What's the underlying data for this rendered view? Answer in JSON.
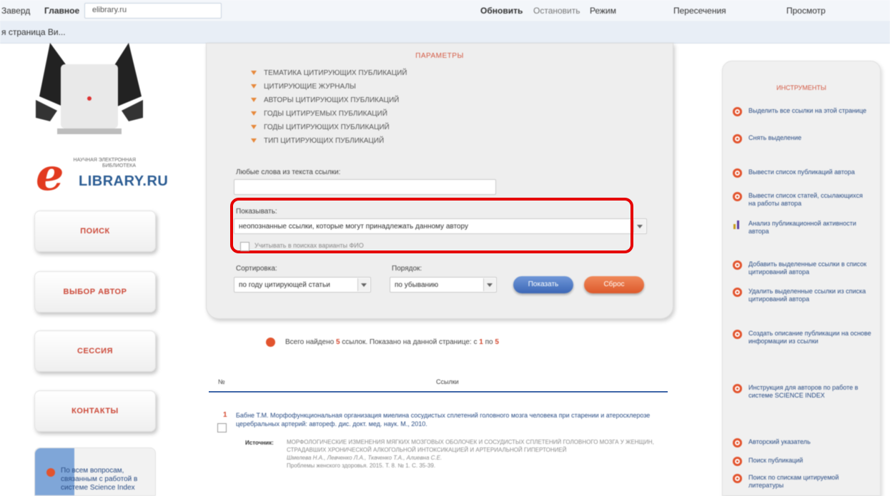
{
  "browser": {
    "tab_left": "Заверд",
    "tab_left2": "Главное",
    "address": "elibrary.ru",
    "refresh_label": "Обновить",
    "stop_label": "Остановить",
    "tools_label": "Режим",
    "page_label": "Пересечения",
    "extra_label": "Просмотр"
  },
  "bookmarks": {
    "page_label": "я страница Ви..."
  },
  "logo": {
    "tagline": "НАУЧНАЯ ЭЛЕКТРОННАЯ БИБЛИОТЕКА",
    "letter": "e",
    "name": "LIBRARY.RU"
  },
  "nav": {
    "search": "ПОИСК",
    "author": "ВЫБОР АВТОР",
    "session": "СЕССИЯ",
    "contacts": "КОНТАКТЫ"
  },
  "info_box": {
    "text": "По всем вопросам, связанным с работой в системе Science Index"
  },
  "params": {
    "title": "ПАРАМЕТРЫ",
    "filters": [
      "ТЕМАТИКА ЦИТИРУЮЩИХ ПУБЛИКАЦИЙ",
      "ЦИТИРУЮЩИЕ ЖУРНАЛЫ",
      "АВТОРЫ ЦИТИРУЮЩИХ ПУБЛИКАЦИЙ",
      "ГОДЫ ЦИТИРУЕМЫХ ПУБЛИКАЦИЙ",
      "ГОДЫ ЦИТИРУЮЩИХ ПУБЛИКАЦИЙ",
      "ТИП ЦИТИРУЮЩИХ ПУБЛИКАЦИЙ"
    ],
    "text_search_label": "Любые слова из текста ссылки:",
    "text_search_value": "",
    "show_label": "Показывать:",
    "show_value": "неопознанные ссылки, которые могут принадлежать данному автору",
    "checkbox_label": "Учитывать в поисках варианты ФИО",
    "sort_label": "Сортировка:",
    "sort_value": "по году цитирующей статьи",
    "order_label": "Порядок:",
    "order_value": "по убыванию",
    "search_button": "Показать",
    "reset_button": "Сброс"
  },
  "results": {
    "found_prefix": "Всего найдено",
    "found_count": "5",
    "found_mid": "ссылок. Показано на данной странице: с",
    "found_from": "1",
    "found_to_label": "по",
    "found_to": "5",
    "col_num": "№",
    "col_refs": "Ссылки",
    "items": [
      {
        "num": "1",
        "text": "Бабне Т.М. Морфофункциональная организация миелина сосудистых сплетений головного мозга человека при старении и атеросклерозе церебральных артерий: автореф. дис. докт. мед. наук. М., 2010.",
        "source_label": "Источник:",
        "source_text": "МОРФОЛОГИЧЕСКИЕ ИЗМЕНЕНИЯ МЯГКИХ МОЗГОВЫХ ОБОЛОЧЕК И СОСУДИСТЫХ СПЛЕТЕНИЙ ГОЛОВНОГО МОЗГА У ЖЕНЩИН, СТРАДАВШИХ ХРОНИЧЕСКОЙ АЛКОГОЛЬНОЙ ИНТОКСИКАЦИЕЙ И АРТЕРИАЛЬНОЙ ГИПЕРТОНИЕЙ",
        "source_authors": "Шмелева Н.А., Левченко Л.А., Ткаченко Т.А., Алиевна С.Е.",
        "source_journal": "Проблемы женского здоровья. 2015. Т. 8. № 1. С. 35-39."
      }
    ]
  },
  "tools": {
    "title": "ИНСТРУМЕНТЫ",
    "items": [
      "Выделить все ссылки на этой странице",
      "Снять выделение",
      "Вывести список публикаций автора",
      "Вывести список статей, ссылающихся на работы автора",
      "Анализ публикационной активности автора",
      "Добавить выделенные ссылки в список цитирований автора",
      "Удалить выделенные ссылки из списка цитирований автора",
      "Создать описание публикации на основе информации из ссылки",
      "Инструкция для авторов по работе в системе SCIENCE INDEX",
      "Авторский указатель",
      "Поиск публикаций",
      "Поиск по спискам цитируемой литературы"
    ]
  }
}
